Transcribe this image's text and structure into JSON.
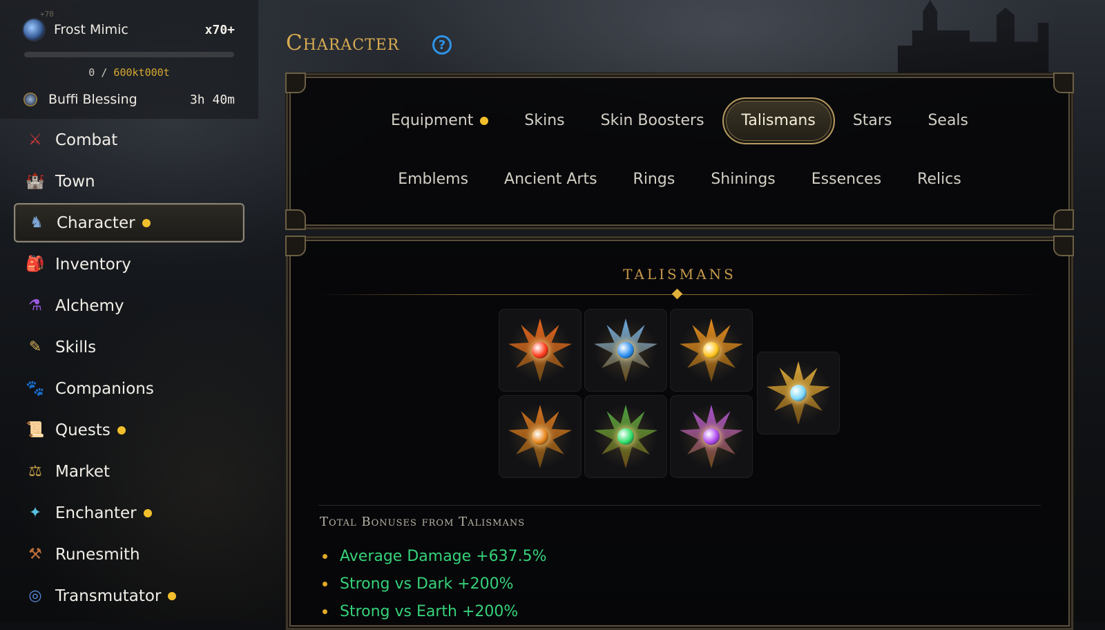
{
  "header": {
    "title": "Character"
  },
  "status": {
    "level_tag": "+70",
    "boss_name": "Frost Mimic",
    "multiplier": "x70+",
    "progress_current": "0",
    "progress_separator": "/",
    "progress_max": "600kt000t",
    "progress_fraction": 0.0,
    "buff_name": "Buffi Blessing",
    "buff_time": "3h 40m"
  },
  "sidebar": {
    "items": [
      {
        "label": "Combat",
        "icon": "crossed-swords-icon",
        "glyph": "⚔",
        "color": "#d23a3a",
        "dot": false
      },
      {
        "label": "Town",
        "icon": "castle-icon",
        "glyph": "🏰",
        "color": "#d9a24a",
        "dot": false
      },
      {
        "label": "Character",
        "icon": "knight-icon",
        "glyph": "♞",
        "color": "#7fa6d8",
        "dot": true,
        "active": true
      },
      {
        "label": "Inventory",
        "icon": "backpack-icon",
        "glyph": "🎒",
        "color": "#c07a3a",
        "dot": false
      },
      {
        "label": "Alchemy",
        "icon": "potion-icon",
        "glyph": "⚗",
        "color": "#9a5ae0",
        "dot": false
      },
      {
        "label": "Skills",
        "icon": "scroll-icon",
        "glyph": "✎",
        "color": "#d9b35a",
        "dot": false
      },
      {
        "label": "Companions",
        "icon": "paw-icon",
        "glyph": "🐾",
        "color": "#7dbd4a",
        "dot": false
      },
      {
        "label": "Quests",
        "icon": "quest-scroll-icon",
        "glyph": "📜",
        "color": "#d05050",
        "dot": true
      },
      {
        "label": "Market",
        "icon": "scales-icon",
        "glyph": "⚖",
        "color": "#c9a24a",
        "dot": false
      },
      {
        "label": "Enchanter",
        "icon": "crystal-icon",
        "glyph": "✦",
        "color": "#5ac0e0",
        "dot": true
      },
      {
        "label": "Runesmith",
        "icon": "hammer-icon",
        "glyph": "⚒",
        "color": "#c0703a",
        "dot": false
      },
      {
        "label": "Transmutator",
        "icon": "swirl-orb-icon",
        "glyph": "◎",
        "color": "#5a8ae0",
        "dot": true
      }
    ]
  },
  "tabs": {
    "row1": [
      {
        "label": "Equipment",
        "dot": true
      },
      {
        "label": "Skins"
      },
      {
        "label": "Skin Boosters"
      },
      {
        "label": "Talismans",
        "active": true
      },
      {
        "label": "Stars"
      },
      {
        "label": "Seals"
      }
    ],
    "row2": [
      {
        "label": "Emblems"
      },
      {
        "label": "Ancient Arts"
      },
      {
        "label": "Rings"
      },
      {
        "label": "Shinings"
      },
      {
        "label": "Essences"
      },
      {
        "label": "Relics"
      }
    ]
  },
  "talismans": {
    "section_title": "TALISMANS",
    "items": [
      {
        "name": "fire-talisman-icon",
        "ray": "#e2621f",
        "orb": "#ff3a1a"
      },
      {
        "name": "frost-talisman-icon",
        "ray": "#6aa8e0",
        "orb": "#2c8ff0"
      },
      {
        "name": "sun-talisman-icon",
        "ray": "#e08a1f",
        "orb": "#ffc21a"
      },
      {
        "name": "prism-talisman-icon",
        "ray": "#d9a83a",
        "orb": "#7ad8ff"
      },
      {
        "name": "amber-talisman-icon",
        "ray": "#d0701f",
        "orb": "#e8851a"
      },
      {
        "name": "nature-talisman-icon",
        "ray": "#4aa040",
        "orb": "#2ee06a"
      },
      {
        "name": "arcane-talisman-icon",
        "ray": "#a650d0",
        "orb": "#b04af0"
      }
    ]
  },
  "bonuses": {
    "title": "Total Bonuses from Talismans",
    "items": [
      "Average Damage +637.5%",
      "Strong vs Dark +200%",
      "Strong vs Earth +200%"
    ]
  },
  "colors": {
    "accent_gold": "#d9ac52",
    "bonus_green": "#36d27a",
    "notification": "#f2bf2c",
    "help_blue": "#2e94e8"
  }
}
